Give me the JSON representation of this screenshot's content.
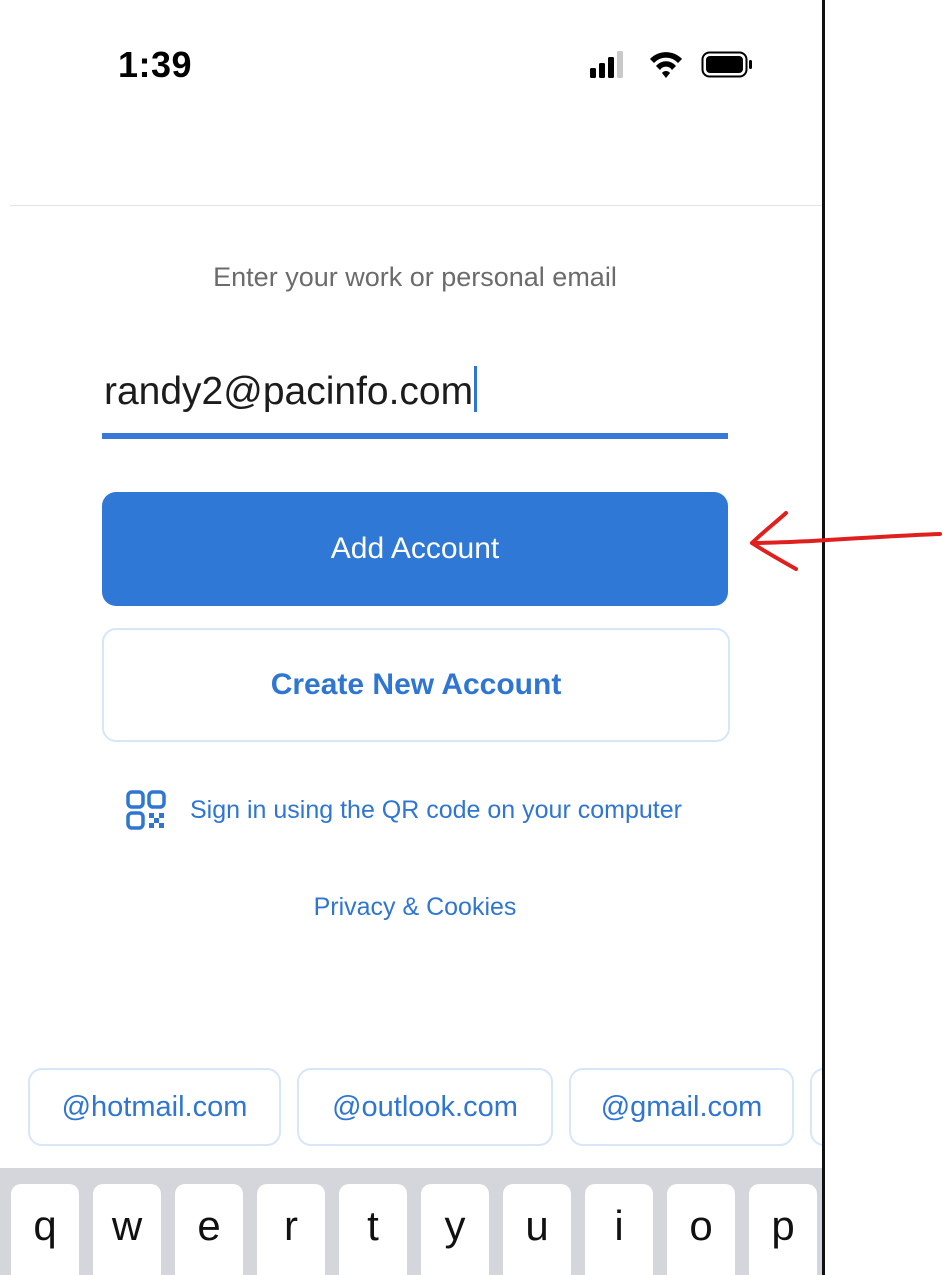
{
  "status_bar": {
    "time": "1:39",
    "icons": [
      "cellular-signal-icon",
      "wifi-icon",
      "battery-icon"
    ]
  },
  "form": {
    "prompt": "Enter your work or personal email",
    "email_value": "randy2@pacinfo.com",
    "add_account_label": "Add Account",
    "create_account_label": "Create New Account",
    "qr_signin_label": "Sign in using the QR code on your computer",
    "privacy_label": "Privacy & Cookies"
  },
  "suggestions": [
    "@hotmail.com",
    "@outlook.com",
    "@gmail.com"
  ],
  "keyboard": {
    "row1": [
      "q",
      "w",
      "e",
      "r",
      "t",
      "y",
      "u",
      "i",
      "o",
      "p"
    ]
  },
  "colors": {
    "accent": "#2f78d6",
    "link": "#2f76d2",
    "annotation": "#e0201e",
    "keyboard_bg": "#d4d6db"
  }
}
